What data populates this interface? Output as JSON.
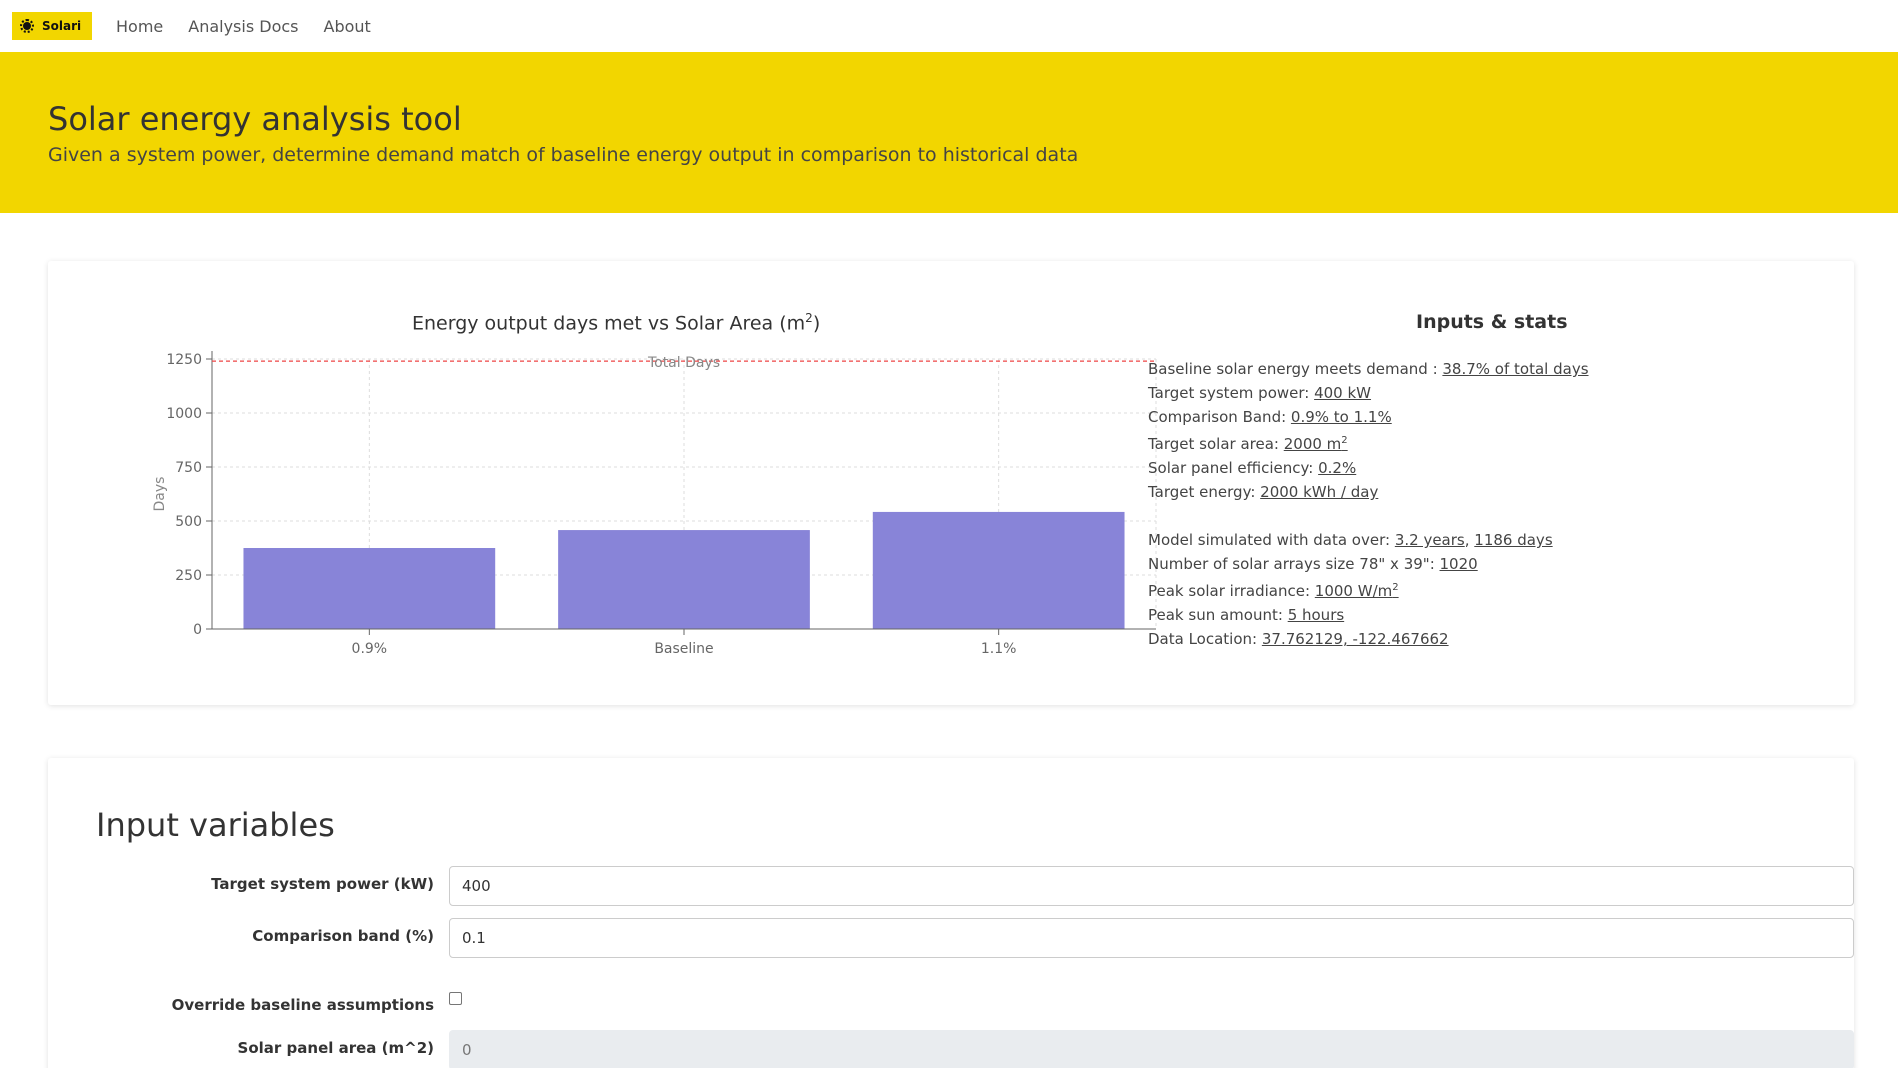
{
  "nav": {
    "brand": "Solari",
    "links": [
      "Home",
      "Analysis Docs",
      "About"
    ]
  },
  "hero": {
    "title": "Solar energy analysis tool",
    "subtitle": "Given a system power, determine demand match of baseline energy output in comparison to historical data"
  },
  "chart": {
    "title_prefix": "Energy output days met vs Solar Area (m",
    "title_sup": "2",
    "title_suffix": ")"
  },
  "chart_data": {
    "type": "bar",
    "title": "Energy output days met vs Solar Area (m2)",
    "categories": [
      "0.9%",
      "Baseline",
      "1.1%"
    ],
    "values": [
      375,
      458,
      542
    ],
    "ylabel": "Days",
    "xlabel": "",
    "ylim": [
      0,
      1250
    ],
    "yticks": [
      0,
      250,
      500,
      750,
      1000,
      1250
    ],
    "reference_line": {
      "value": 1240,
      "label": "Total Days",
      "color": "#ee4444"
    },
    "bar_color": "#8884d8",
    "grid": true
  },
  "stats": {
    "title": "Inputs & stats",
    "baseline_label": "Baseline solar energy meets demand : ",
    "baseline_value": "38.7% of total days",
    "power_label": "Target system power: ",
    "power_value": "400 kW",
    "band_label": "Comparison Band: ",
    "band_value": "0.9% to 1.1%",
    "area_label": "Target solar area: ",
    "area_value": "2000 m",
    "area_sup": "2",
    "efficiency_label": "Solar panel efficiency: ",
    "efficiency_value": "0.2%",
    "energy_label": "Target energy: ",
    "energy_value": "2000 kWh / day",
    "sim_label": "Model simulated with data over: ",
    "sim_years": "3.2 years",
    "sim_sep": ", ",
    "sim_days": "1186 days",
    "arrays_label": "Number of solar arrays size 78\" x 39\": ",
    "arrays_value": "1020",
    "irradiance_label": "Peak solar irradiance: ",
    "irradiance_value": "1000 W/m",
    "irradiance_sup": "2",
    "sun_label": "Peak sun amount: ",
    "sun_value": "5 hours",
    "location_label": "Data Location: ",
    "location_value": "37.762129, -122.467662"
  },
  "inputs": {
    "title": "Input variables",
    "power_label": "Target system power (kW)",
    "power_value": "400",
    "band_label": "Comparison band (%)",
    "band_value": "0.1",
    "override_label": "Override baseline assumptions",
    "area_label": "Solar panel area (m^2)",
    "area_value": "0"
  },
  "colors": {
    "accent": "#f2d600",
    "bar": "#8884d8",
    "reference": "#ee4444"
  }
}
